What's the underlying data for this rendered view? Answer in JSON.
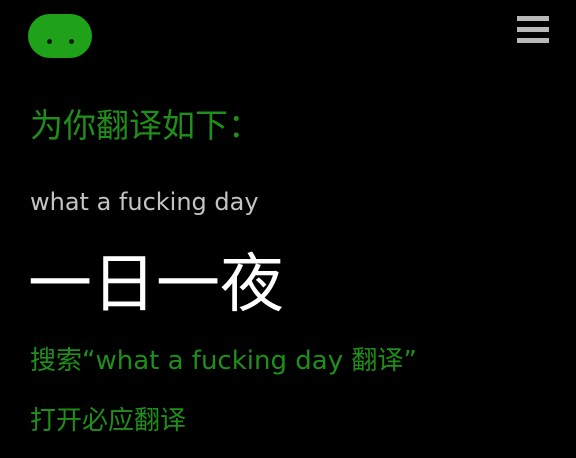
{
  "header": {
    "logo_icon": "green-blob-logo-icon",
    "menu_icon": "hamburger-menu-icon"
  },
  "translation": {
    "heading": "为你翻译如下：",
    "source_text": "what a fucking day",
    "result_text": "一日一夜"
  },
  "links": {
    "search_label": "搜索“what a fucking day 翻译”",
    "open_app_label": "打开必应翻译"
  },
  "colors": {
    "background": "#000000",
    "accent": "#1f8e1a",
    "logo": "#1fa11a",
    "source_text": "#c4c4c4",
    "result_text": "#ffffff",
    "menu": "#b8b8b8"
  }
}
